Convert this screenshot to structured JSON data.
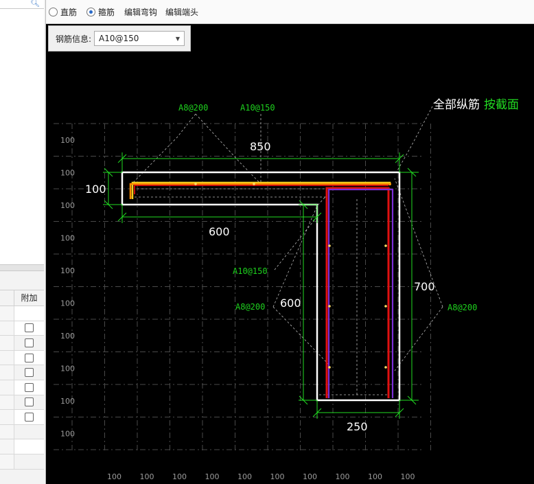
{
  "left_panel": {
    "search_icon": "search-icon",
    "column_header": "附加",
    "rows": 8,
    "checkbox_rows": 8
  },
  "toolbar": {
    "radio_straight": "直筋",
    "radio_stirrup": "箍筋",
    "selected": "箍筋",
    "edit_hook": "编辑弯钩",
    "edit_end": "编辑端头"
  },
  "rebar_info": {
    "label": "钢筋信息:",
    "value": "A10@150"
  },
  "drawing": {
    "grid_label": "100",
    "top_note_white": "全部纵筋",
    "top_note_green": "按截面",
    "dim_850": "850",
    "dim_100": "100",
    "dim_600_bottom": "600",
    "dim_600_left": "600",
    "dim_700": "700",
    "dim_250": "250",
    "ann_top_a8": "A8@200",
    "ann_top_a10": "A10@150",
    "ann_mid_a10": "A10@150",
    "ann_mid_a8": "A8@200",
    "ann_right_a8": "A8@200"
  },
  "colors": {
    "canvas_bg": "#000000",
    "section_outline": "#ffffff",
    "dimension": "#22dd22",
    "stirrup_orange": "#ff8c00",
    "stirrup_red": "#e01010",
    "stirrup_purple": "#7b2fd6",
    "stirrup_yellow": "#f0d020"
  }
}
